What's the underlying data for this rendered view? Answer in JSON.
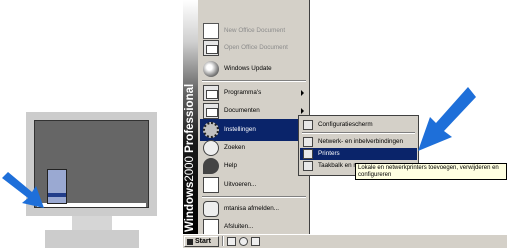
{
  "banner": {
    "bold": "Windows",
    "thin": "2000",
    "bold2": " Professional"
  },
  "start_menu": {
    "items": [
      {
        "label": "New Office Document",
        "icon": "new-document-icon",
        "dim": true,
        "arrow": false
      },
      {
        "label": "Open Office Document",
        "icon": "open-document-icon",
        "dim": true,
        "arrow": false
      },
      {
        "label": "Windows Update",
        "icon": "globe-icon",
        "dim": false,
        "arrow": false
      },
      {
        "label": "Programma's",
        "icon": "programs-folder-icon",
        "dim": false,
        "arrow": true
      },
      {
        "label": "Documenten",
        "icon": "documents-folder-icon",
        "dim": false,
        "arrow": true
      },
      {
        "label": "Instellingen",
        "icon": "settings-icon",
        "dim": false,
        "arrow": true
      },
      {
        "label": "Zoeken",
        "icon": "search-icon",
        "dim": false,
        "arrow": true
      },
      {
        "label": "Help",
        "icon": "help-icon",
        "dim": false,
        "arrow": false
      },
      {
        "label": "Uitvoeren...",
        "icon": "run-icon",
        "dim": false,
        "arrow": false
      },
      {
        "label": "mtanisa afmelden...",
        "icon": "logoff-key-icon",
        "dim": false,
        "arrow": false
      },
      {
        "label": "Afsluiten...",
        "icon": "shutdown-icon",
        "dim": false,
        "arrow": false
      }
    ]
  },
  "settings_submenu": {
    "items": [
      {
        "label": "Configuratiescherm"
      },
      {
        "label": "Netwerk- en inbelverbindingen"
      },
      {
        "label": "Printers"
      },
      {
        "label": "Taakbalk en m"
      }
    ]
  },
  "tooltip": {
    "line1": "Lokale en netwerkprinters toevoegen, verwijderen en",
    "line2": "configureren"
  },
  "taskbar": {
    "start_label": "Start"
  },
  "colors": {
    "highlight": "#0a246a",
    "menu_bg": "#d4d0c8",
    "arrow_blue": "#1e6fd9",
    "tooltip_bg": "#ffffe1"
  }
}
